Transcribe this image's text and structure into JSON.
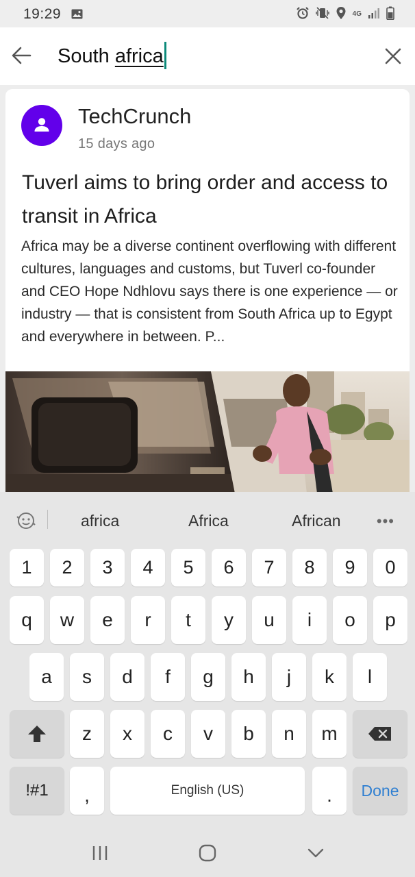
{
  "status_bar": {
    "time": "19:29",
    "network": "4G"
  },
  "search": {
    "query_prefix": "South ",
    "query_typed": "africa"
  },
  "article": {
    "source": "TechCrunch",
    "time_ago": "15 days ago",
    "headline": "Tuverl aims to bring order and access to transit in Africa",
    "snippet": "Africa may be a diverse continent overflowing with different cultures, languages and customs, but Tuverl co-founder and CEO Hope Ndhlovu says there is one experience — or industry — that is consistent from South Africa up to Egypt and everywhere in between. P...",
    "accent_color": "#6200ea"
  },
  "keyboard": {
    "suggestions": [
      "africa",
      "Africa",
      "African"
    ],
    "more": "•••",
    "number_row": [
      "1",
      "2",
      "3",
      "4",
      "5",
      "6",
      "7",
      "8",
      "9",
      "0"
    ],
    "row1": [
      "q",
      "w",
      "e",
      "r",
      "t",
      "y",
      "u",
      "i",
      "o",
      "p"
    ],
    "row2": [
      "a",
      "s",
      "d",
      "f",
      "g",
      "h",
      "j",
      "k",
      "l"
    ],
    "row3": [
      "z",
      "x",
      "c",
      "v",
      "b",
      "n",
      "m"
    ],
    "symbols_label": "!#1",
    "comma": ",",
    "space_label": "English (US)",
    "period": ".",
    "done_label": "Done",
    "done_color": "#2f7fd1"
  }
}
